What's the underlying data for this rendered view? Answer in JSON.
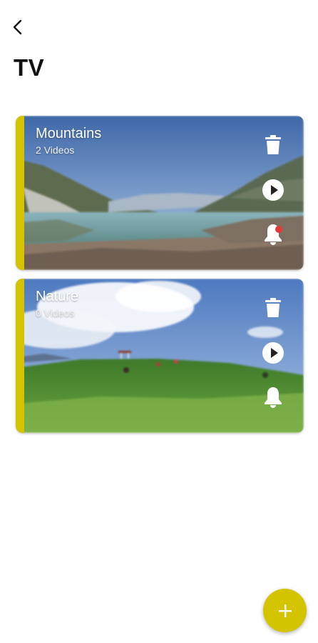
{
  "header": {
    "back_icon": "chevron-left-icon",
    "title": "TV"
  },
  "accent_color": "#d4c400",
  "notification_color": "#e53935",
  "playlists": [
    {
      "name": "Mountains",
      "count": "2 Videos",
      "has_notification": true
    },
    {
      "name": "Nature",
      "count": "0 Videos",
      "has_notification": false
    }
  ],
  "actions": {
    "delete_icon": "trash-icon",
    "play_icon": "play-circle-icon",
    "notify_icon": "bell-icon"
  },
  "fab": {
    "icon": "plus-icon"
  }
}
